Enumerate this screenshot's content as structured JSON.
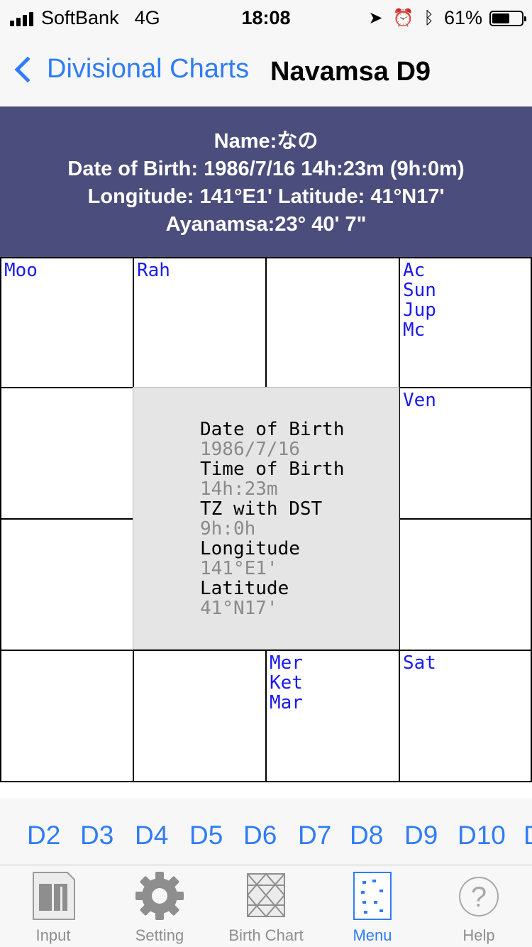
{
  "status": {
    "carrier": "SoftBank",
    "network": "4G",
    "time": "18:08",
    "battery_percent": "61%",
    "battery_level": 0.61,
    "icons": [
      "location-arrow-icon",
      "alarm-icon",
      "bluetooth-icon"
    ]
  },
  "nav": {
    "back_label": "Divisional Charts",
    "title": "Navamsa D9"
  },
  "header_info": {
    "name_line": "Name:なの",
    "dob_line": "Date of Birth: 1986/7/16 14h:23m (9h:0m)",
    "location_line": "Longitude: 141°E1' Latitude: 41°N17'",
    "ayanamsa_line": "Ayanamsa:23° 40' 7\""
  },
  "chart": {
    "houses": [
      {
        "planets": [
          "Moo"
        ]
      },
      {
        "planets": [
          "Rah"
        ]
      },
      {
        "planets": []
      },
      {
        "planets": [
          "Ac",
          "Sun",
          "Jup",
          "Mc"
        ]
      },
      {
        "planets": []
      },
      {
        "planets": [
          "Ven"
        ]
      },
      {
        "planets": []
      },
      {
        "planets": []
      },
      {
        "planets": []
      },
      {
        "planets": []
      },
      {
        "planets": [
          "Mer",
          "Ket",
          "Mar"
        ]
      },
      {
        "planets": [
          "Sat"
        ]
      }
    ],
    "center": {
      "dob_label": "Date of Birth",
      "dob_value": "1986/7/16",
      "tob_label": "Time of Birth",
      "tob_value": "14h:23m",
      "tz_label": "TZ with DST",
      "tz_value": "9h:0h",
      "longitude_label": "Longitude",
      "longitude_value": "141°E1'",
      "latitude_label": "Latitude",
      "latitude_value": "41°N17'"
    }
  },
  "divisions": [
    "D2",
    "D3",
    "D4",
    "D5",
    "D6",
    "D7",
    "D8",
    "D9",
    "D10",
    "D"
  ],
  "tabbar": {
    "items": [
      {
        "label": "Input",
        "icon": "input-icon"
      },
      {
        "label": "Setting",
        "icon": "gear-icon"
      },
      {
        "label": "Birth Chart",
        "icon": "birth-chart-icon"
      },
      {
        "label": "Menu",
        "icon": "menu-icon"
      },
      {
        "label": "Help",
        "icon": "help-icon"
      }
    ],
    "active_label": "Menu"
  },
  "colors": {
    "accent": "#2f7cf6",
    "banner": "#4b4e7c",
    "planet_text": "#1a1aee",
    "center_bg": "#e5e5e5"
  }
}
